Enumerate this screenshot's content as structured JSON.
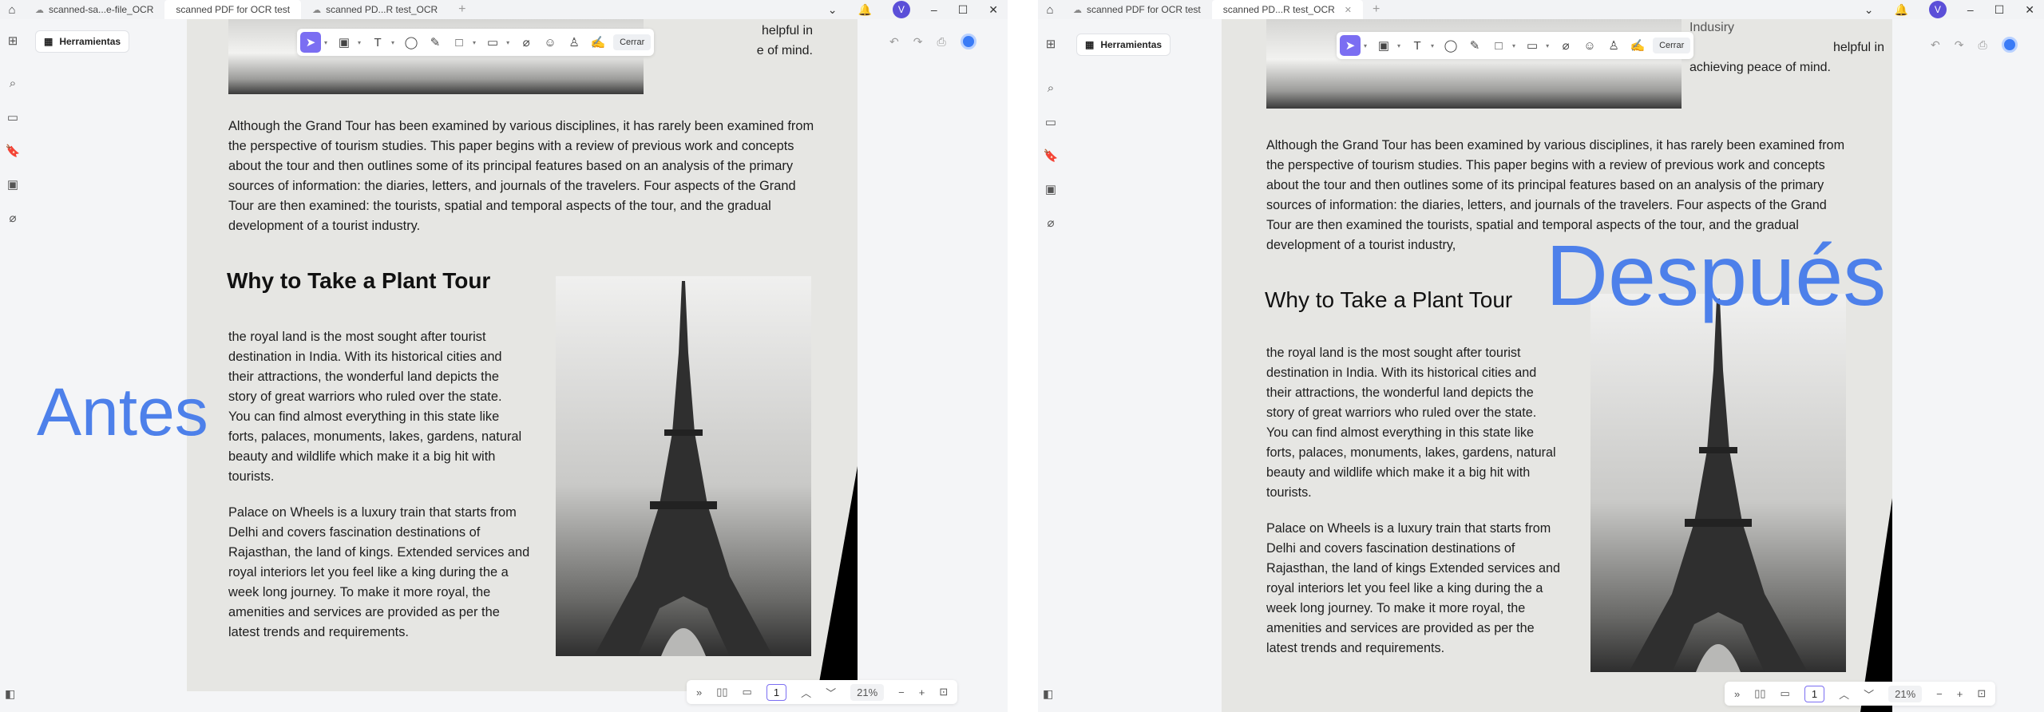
{
  "left": {
    "tabs": [
      {
        "label": "scanned-sa...e-file_OCR",
        "active": false
      },
      {
        "label": "scanned PDF for OCR test",
        "active": true
      },
      {
        "label": "scanned PD...R test_OCR",
        "active": false
      }
    ],
    "avatar": "V",
    "tools_label": "Herramientas",
    "close_label": "Cerrar",
    "overlay": "Antes",
    "page": "1",
    "zoom": "21%",
    "top_fragment": [
      "helpful  in",
      "e of mind."
    ],
    "para1": [
      "Although the Grand Tour has been examined by various disciplines, it has rarely been examined from",
      "the perspective of tourism studies. This paper begins with a review of previous work and concepts",
      "about the tour and then outlines some of its principal features based on an analysis of the primary",
      "sources of information: the diaries, letters, and journals of the travelers. Four aspects of the Grand",
      "Tour are then examined: the tourists, spatial and temporal aspects of the tour, and the gradual",
      "development of a tourist industry."
    ],
    "heading": "Why to Take a Plant Tour",
    "para2": [
      "the royal land is the most sought after tourist",
      "destination in India. With its historical cities and",
      "their attractions, the wonderful land depicts the",
      "story of great warriors who ruled over the state.",
      "You can find almost everything in this state like",
      "forts, palaces, monuments, lakes, gardens, natural",
      "beauty and wildlife which make it a big hit with",
      "tourists."
    ],
    "para3": [
      "Palace on Wheels is a luxury train that starts from",
      "Delhi and covers fascination destinations of",
      "Rajasthan, the land of kings. Extended services and",
      "royal interiors let you feel like a king during the a",
      "week long journey. To make it more royal, the",
      "amenities and services are provided as per the",
      "latest trends and requirements."
    ]
  },
  "right": {
    "tabs": [
      {
        "label": "scanned PDF for OCR test",
        "active": false
      },
      {
        "label": "scanned PD...R test_OCR",
        "active": true
      }
    ],
    "avatar": "V",
    "tools_label": "Herramientas",
    "close_label": "Cerrar",
    "overlay": "Después",
    "page": "1",
    "zoom": "21%",
    "top_fragment": [
      "Indusiry",
      "helpful    in",
      "achieving peace of mind."
    ],
    "para1": [
      "Although the Grand Tour has been examined by various disciplines, it has rarely been examined from",
      "the perspective of tourism studies. This paper begins with a review of previous work and concepts",
      "about the tour and then outlines some of its principal features based on an analysis of the primary",
      "sources of information: the diaries, letters, and journals of the travelers. Four aspects of the Grand",
      "Tour are then examined the tourists, spatial and temporal aspects of the tour, and the gradual",
      "development of a tourist industry,"
    ],
    "heading": "Why to Take a Plant Tour",
    "para2": [
      "the royal land is the most sought after tourist",
      "destination in India. With its historical cities and",
      "their attractions, the wonderful land depicts the",
      "story of great warriors who ruled over the state.",
      "You can find almost everything in this state like",
      "forts, palaces, monuments, lakes, gardens, natural",
      "beauty and wildlife which make it a big hit with",
      "tourists."
    ],
    "para3": [
      "Palace on Wheels is a luxury train that starts from",
      "Delhi and covers fascination destinations of",
      "Rajasthan, the land of kings Extended services and",
      "royal interiors let you feel like a king during the a",
      "week long journey. To make it more royal, the",
      "amenities and services are provided as per the",
      "latest trends and requirements."
    ]
  },
  "colors": {
    "accent": "#7b6ef2",
    "overlay_text": "#4d80ea",
    "avatar": "#5b4fd8"
  }
}
